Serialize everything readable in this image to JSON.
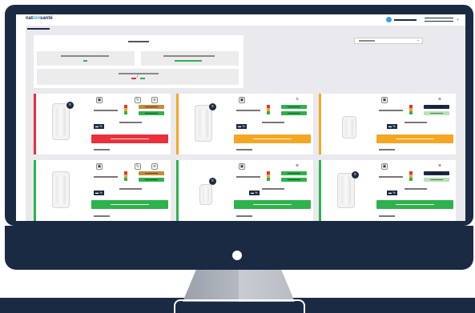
{
  "app": {
    "logo_text_a": "nat",
    "logo_text_b": "ion",
    "logo_text_c": "santé"
  },
  "summary": {
    "ratio_separator": "/"
  },
  "colors": {
    "navy": "#1b2a43",
    "green": "#2eb24b",
    "orange": "#f5a623",
    "red": "#e8313a",
    "brown": "#c48a3a",
    "light_green": "#b6e3b3"
  },
  "cards": [
    {
      "status": "red",
      "icons": [
        "filter-icon",
        "refresh-icon",
        "wifi-icon"
      ],
      "pills": [
        "brown",
        "green"
      ],
      "badge": "≡",
      "tag": "▬ %"
    },
    {
      "status": "orange",
      "icons": [
        "filter-icon",
        "no-wifi-icon"
      ],
      "pills": [
        "green",
        "green"
      ],
      "badge": "≡",
      "tag": "▬ %"
    },
    {
      "status": "orange",
      "icons": [
        "filter-icon",
        "wifi-icon"
      ],
      "pills": [
        "navy",
        "light_green"
      ],
      "badge": "",
      "tag": "▬ %"
    },
    {
      "status": "green",
      "icons": [
        "filter-icon",
        "refresh-icon",
        "wifi-icon"
      ],
      "pills": [
        "brown",
        "green"
      ],
      "badge": "",
      "tag": "▬ %"
    },
    {
      "status": "green",
      "icons": [
        "filter-icon",
        "wifi-icon"
      ],
      "pills": [
        "green",
        "green"
      ],
      "badge": "≡",
      "tag": "▬ %"
    },
    {
      "status": "green",
      "icons": [
        "filter-icon",
        "wifi-icon"
      ],
      "pills": [
        "navy",
        "light_green"
      ],
      "badge": "≡",
      "tag": "▬ %"
    }
  ]
}
